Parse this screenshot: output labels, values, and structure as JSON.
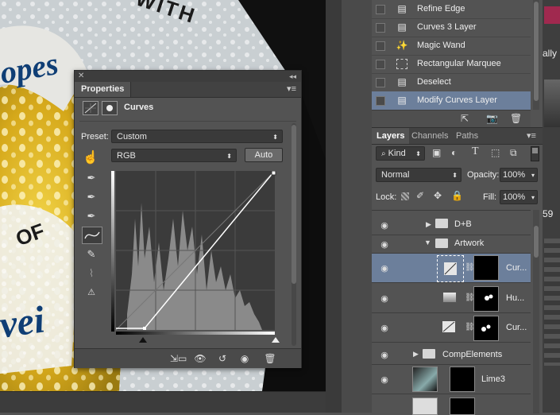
{
  "canvas": {
    "label_text_top": "WITH",
    "label_text_brand": "opes",
    "label_text_of": "OF",
    "label_text_bottom": "vei"
  },
  "properties": {
    "tab_label": "Properties",
    "adjustment_title": "Curves",
    "preset_label": "Preset:",
    "preset_value": "Custom",
    "channel_value": "RGB",
    "auto_label": "Auto"
  },
  "history": {
    "items": [
      {
        "label": "Refine Edge",
        "icon": "document-icon"
      },
      {
        "label": "Curves 3 Layer",
        "icon": "document-icon"
      },
      {
        "label": "Magic Wand",
        "icon": "magic-wand-icon"
      },
      {
        "label": "Rectangular Marquee",
        "icon": "marquee-icon"
      },
      {
        "label": "Deselect",
        "icon": "document-icon"
      },
      {
        "label": "Modify Curves Layer",
        "icon": "document-icon"
      }
    ]
  },
  "layers": {
    "tabs": [
      "Layers",
      "Channels",
      "Paths"
    ],
    "filter_kind": "Kind",
    "blend_mode": "Normal",
    "opacity_label": "Opacity:",
    "opacity_value": "100%",
    "lock_label": "Lock:",
    "fill_label": "Fill:",
    "fill_value": "100%",
    "rows": [
      {
        "name": "D+B",
        "type": "group"
      },
      {
        "name": "Artwork",
        "type": "group-open"
      },
      {
        "name": "Cur...",
        "type": "curves"
      },
      {
        "name": "Hu...",
        "type": "hue"
      },
      {
        "name": "Cur...",
        "type": "curves"
      },
      {
        "name": "CompElements",
        "type": "group"
      },
      {
        "name": "Lime3",
        "type": "image"
      }
    ]
  },
  "right_strip": {
    "text_ally": "ally",
    "text_59": "59"
  },
  "colors": {
    "selection": "#6c7f9b",
    "panel": "#535353"
  }
}
